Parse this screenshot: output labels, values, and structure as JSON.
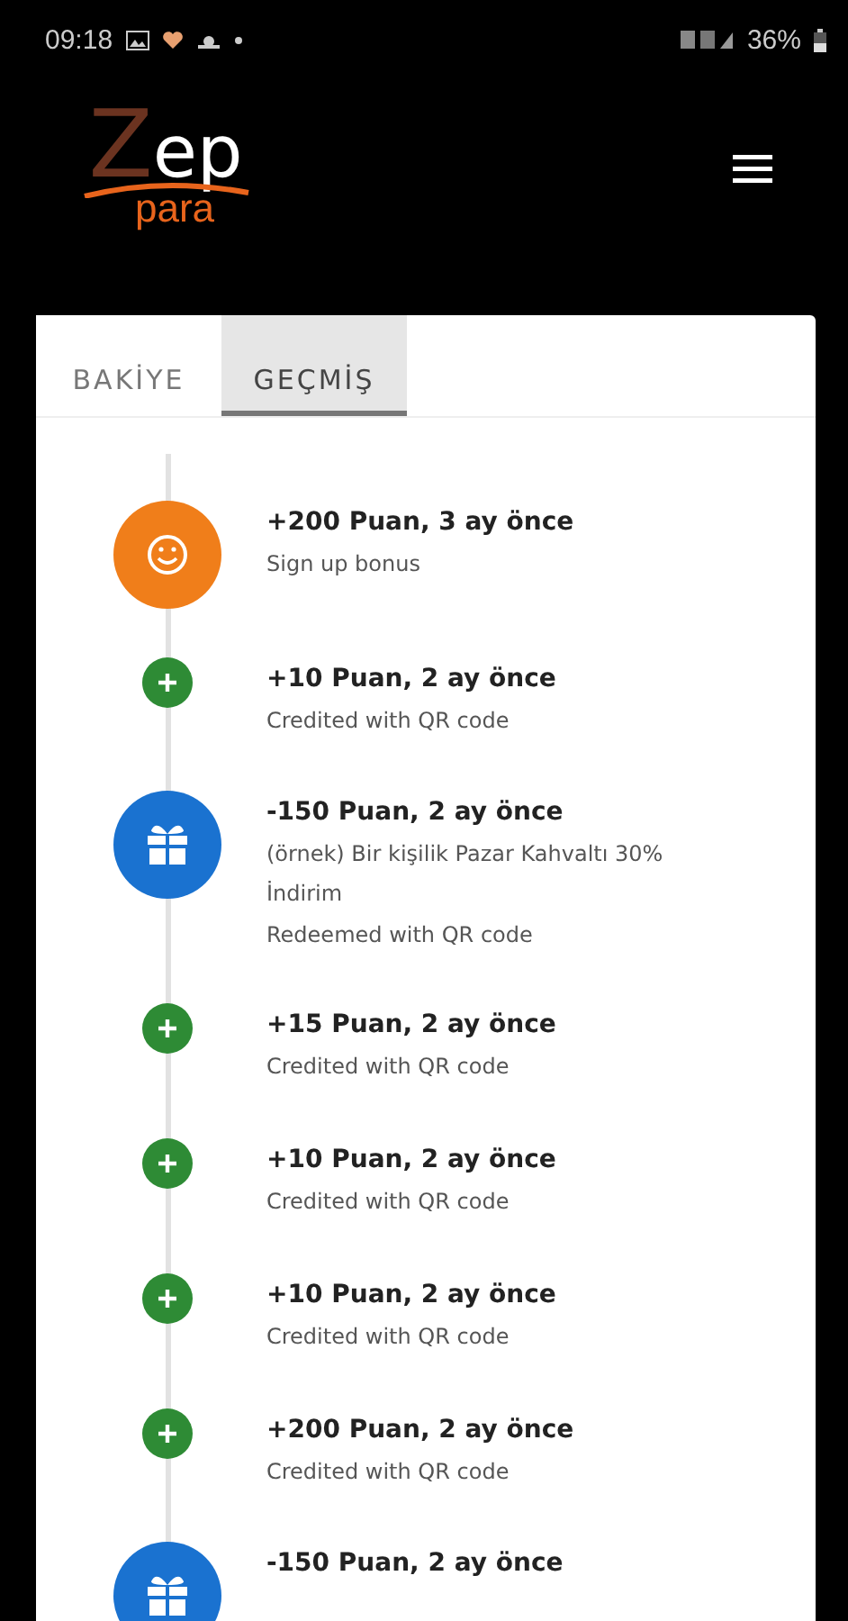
{
  "status_bar": {
    "time": "09:18",
    "battery": "36%"
  },
  "header": {
    "logo": {
      "word": "Zep",
      "sub": "para"
    }
  },
  "tabs": [
    {
      "label": "BAKİYE",
      "selected": false
    },
    {
      "label": "GEÇMİŞ",
      "selected": true
    }
  ],
  "history": [
    {
      "kind": "signup",
      "title": "+200 Puan, 3 ay önce",
      "lines": [
        "Sign up bonus"
      ]
    },
    {
      "kind": "credit",
      "title": "+10 Puan, 2 ay önce",
      "lines": [
        "Credited with QR code"
      ]
    },
    {
      "kind": "redeem",
      "title": "-150 Puan, 2 ay önce",
      "lines": [
        "(örnek) Bir kişilik Pazar Kahvaltı 30% İndirim",
        "Redeemed with QR code"
      ]
    },
    {
      "kind": "credit",
      "title": "+15 Puan, 2 ay önce",
      "lines": [
        "Credited with QR code"
      ]
    },
    {
      "kind": "credit",
      "title": "+10 Puan, 2 ay önce",
      "lines": [
        "Credited with QR code"
      ]
    },
    {
      "kind": "credit",
      "title": "+10 Puan, 2 ay önce",
      "lines": [
        "Credited with QR code"
      ]
    },
    {
      "kind": "credit",
      "title": "+200 Puan, 2 ay önce",
      "lines": [
        "Credited with QR code"
      ]
    },
    {
      "kind": "redeem",
      "title": "-150 Puan, 2 ay önce"
    }
  ]
}
